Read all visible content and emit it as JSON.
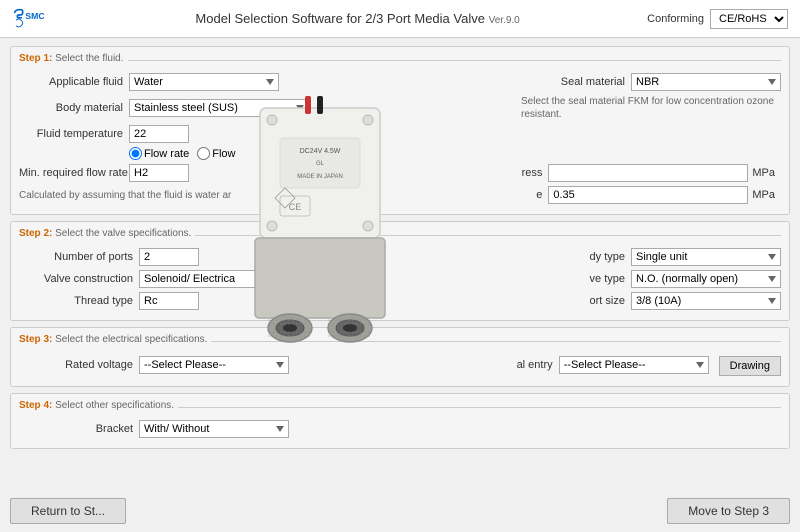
{
  "header": {
    "title": "Model Selection Software for 2/3 Port Media Valve",
    "version": "Ver.9.0",
    "conforming_label": "Conforming",
    "conforming_options": [
      "CE/RoHS"
    ],
    "conforming_selected": "CE/RoHS"
  },
  "steps": {
    "step1": {
      "label": "Step 1:",
      "description": "Select the fluid.",
      "fields": {
        "applicable_fluid_label": "Applicable fluid",
        "applicable_fluid_value": "Water",
        "body_material_label": "Body material",
        "body_material_value": "Stainless steel (SUS)",
        "seal_material_label": "Seal material",
        "seal_material_value": "NBR",
        "fluid_temp_label": "Fluid temperature",
        "fluid_temp_value": "22",
        "flow_rate_label": "Flow rate",
        "flow_label2": "Flow",
        "min_flow_label": "Min. required flow rate",
        "min_flow_value": "H2",
        "pressure_value": "",
        "pressure_max": "0.35",
        "mpa_label": "MPa",
        "mpa_label2": "MPa",
        "note": "Select the seal material FKM for low concentration ozone resistant.",
        "note2": "Calculated by assuming that the fluid is water ar"
      }
    },
    "step2": {
      "label": "Step 2:",
      "description": "Select the valve specifications.",
      "fields": {
        "num_ports_label": "Number of ports",
        "num_ports_value": "2",
        "body_type_label": "dy type",
        "body_type_value": "Single unit",
        "valve_construction_label": "Valve construction",
        "valve_construction_value": "Solenoid/ Electrica",
        "valve_type_label": "ve type",
        "valve_type_value": "N.O. (normally open)",
        "thread_type_label": "Thread type",
        "thread_type_value": "Rc",
        "port_size_label": "ort size",
        "port_size_value": "3/8 (10A)"
      }
    },
    "step3": {
      "label": "Step 3:",
      "description": "Select the electrical specifications.",
      "fields": {
        "rated_voltage_label": "Rated voltage",
        "rated_voltage_value": "--Select Please--",
        "lead_entry_label": "al entry",
        "lead_entry_value": "--Select Please--",
        "drawing_label": "Drawing"
      }
    },
    "step4": {
      "label": "Step 4:",
      "description": "Select other specifications.",
      "fields": {
        "bracket_label": "Bracket",
        "bracket_value": "With/ Without"
      }
    }
  },
  "buttons": {
    "return_label": "Return to St...",
    "move_label": "Move to Step 3"
  }
}
